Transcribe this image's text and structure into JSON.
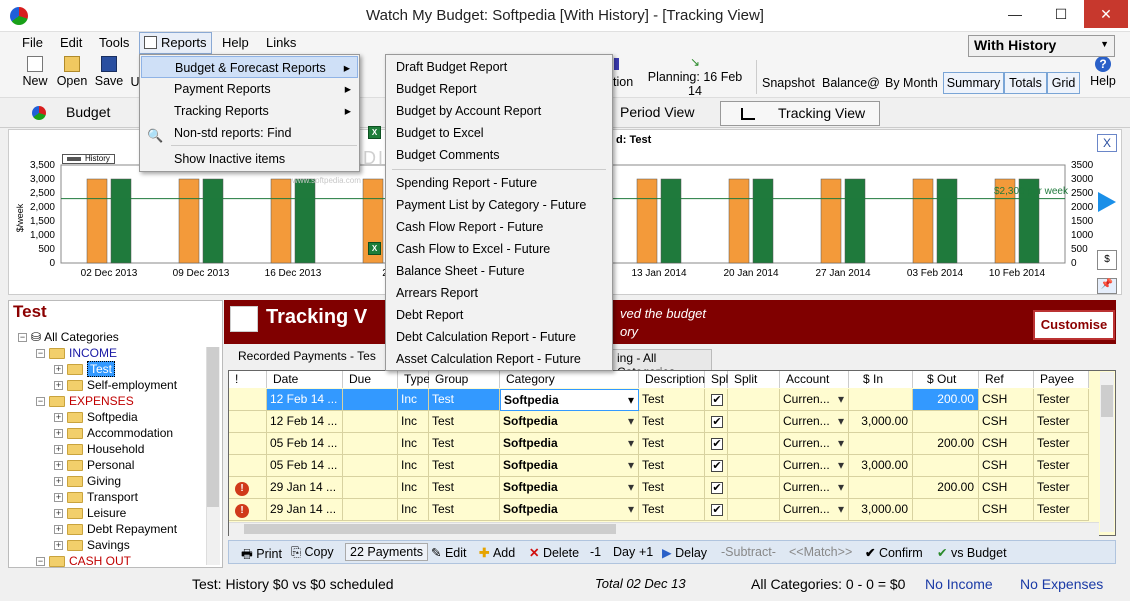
{
  "window": {
    "title": "Watch My Budget: Softpedia [With History] - [Tracking View]",
    "minimize": "—",
    "maximize": "☐",
    "close": "✕"
  },
  "menubar": {
    "items": [
      "File",
      "Edit",
      "Tools",
      "Reports",
      "Help",
      "Links"
    ]
  },
  "toolbar": {
    "new": "New",
    "open": "Open",
    "save": "Save",
    "cut_label": "U",
    "tion": "tion",
    "planning": "Planning: 16 Feb 14",
    "snapshot": "Snapshot",
    "balance": "Balance@",
    "by_month": "By Month",
    "summary": "Summary",
    "totals": "Totals",
    "grid": "Grid",
    "help": "Help",
    "history_select": "With History"
  },
  "viewbar": {
    "budget_view": "Budget View",
    "period_view": "Period View",
    "tracking_view": "Tracking View"
  },
  "chart": {
    "legend_history": "History",
    "right_label": "$2,300 per week",
    "fragment_title": "d: Test",
    "watermark": "SOFTPEDIA",
    "watermark_url": "www.softpedia.com"
  },
  "chart_data": {
    "type": "bar",
    "ylabel": "$/week",
    "ylim": [
      0,
      3500
    ],
    "y_ticks": [
      "3,500",
      "3,000",
      "2,500",
      "2,000",
      "1,500",
      "1,000",
      "500",
      "0"
    ],
    "y_ticks_right": [
      "3500",
      "3000",
      "2500",
      "2000",
      "1500",
      "1000",
      "500",
      "0"
    ],
    "categories": [
      "02 Dec 2013",
      "09 Dec 2013",
      "16 Dec 2013",
      "2",
      "13 Jan 2014",
      "20 Jan 2014",
      "27 Jan 2014",
      "03 Feb 2014",
      "10 Feb 2014"
    ],
    "reference_line": 2300,
    "series": [
      {
        "name": "",
        "color": "#f39a3a",
        "values": [
          3000,
          3000,
          3000,
          3000,
          3000,
          3000,
          3000,
          3000,
          3000
        ]
      },
      {
        "name": "",
        "color": "#1f7a3c",
        "values": [
          3000,
          3000,
          3000,
          3000,
          3000,
          3000,
          3000,
          3000,
          3000
        ]
      }
    ]
  },
  "tree": {
    "title": "Test",
    "items": [
      {
        "label": "All Categories",
        "color": "#000"
      },
      {
        "label": "INCOME",
        "color": "#1a1aa6"
      },
      {
        "label": "Test",
        "color": "#fff",
        "selected": true
      },
      {
        "label": "Self-employment",
        "color": "#000"
      },
      {
        "label": "EXPENSES",
        "color": "#c00000"
      },
      {
        "label": "Softpedia",
        "color": "#000"
      },
      {
        "label": "Accommodation",
        "color": "#000"
      },
      {
        "label": "Household",
        "color": "#000"
      },
      {
        "label": "Personal",
        "color": "#000"
      },
      {
        "label": "Giving",
        "color": "#000"
      },
      {
        "label": "Transport",
        "color": "#000"
      },
      {
        "label": "Leisure",
        "color": "#000"
      },
      {
        "label": "Debt Repayment",
        "color": "#000"
      },
      {
        "label": "Savings",
        "color": "#000"
      },
      {
        "label": "CASH OUT",
        "color": "#c00000"
      }
    ]
  },
  "tracking": {
    "title": "Tracking V",
    "line1": "ved the budget",
    "line2": "ory",
    "customise": "Customise",
    "recorded_tab": "Recorded Payments - Tes",
    "all_cat_tab": "ing - All Categories"
  },
  "grid": {
    "headers": [
      "!",
      "Date",
      "Due",
      "Type",
      "Group",
      "Category",
      "Description",
      "Spl",
      "Split",
      "Account",
      "$ In",
      "$ Out",
      "Ref",
      "Payee"
    ],
    "rows": [
      {
        "flag": "",
        "date": "12 Feb 14 ...",
        "type": "Inc",
        "group": "Test",
        "category": "Softpedia",
        "desc": "Test",
        "account": "Curren...",
        "in": "",
        "out": "200.00",
        "ref": "CSH",
        "payee": "Tester"
      },
      {
        "flag": "",
        "date": "12 Feb 14 ...",
        "type": "Inc",
        "group": "Test",
        "category": "Softpedia",
        "desc": "Test",
        "account": "Curren...",
        "in": "3,000.00",
        "out": "",
        "ref": "CSH",
        "payee": "Tester"
      },
      {
        "flag": "",
        "date": "05 Feb 14 ...",
        "type": "Inc",
        "group": "Test",
        "category": "Softpedia",
        "desc": "Test",
        "account": "Curren...",
        "in": "",
        "out": "200.00",
        "ref": "CSH",
        "payee": "Tester"
      },
      {
        "flag": "",
        "date": "05 Feb 14 ...",
        "type": "Inc",
        "group": "Test",
        "category": "Softpedia",
        "desc": "Test",
        "account": "Curren...",
        "in": "3,000.00",
        "out": "",
        "ref": "CSH",
        "payee": "Tester"
      },
      {
        "flag": "!",
        "date": "29 Jan 14 ...",
        "type": "Inc",
        "group": "Test",
        "category": "Softpedia",
        "desc": "Test",
        "account": "Curren...",
        "in": "",
        "out": "200.00",
        "ref": "CSH",
        "payee": "Tester"
      },
      {
        "flag": "!",
        "date": "29 Jan 14 ...",
        "type": "Inc",
        "group": "Test",
        "category": "Softpedia",
        "desc": "Test",
        "account": "Curren...",
        "in": "3,000.00",
        "out": "",
        "ref": "CSH",
        "payee": "Tester"
      }
    ]
  },
  "bottom_bar": {
    "print": "Print",
    "copy": "Copy",
    "payments": "22 Payments",
    "edit": "Edit",
    "add": "Add",
    "delete": "Delete",
    "minus1": "-1",
    "day": "Day",
    "plus1": "+1",
    "delay": "Delay",
    "subtract": "-Subtract-",
    "match": "<<Match>>",
    "confirm": "Confirm",
    "vs_budget": "vs Budget"
  },
  "status": {
    "left": "Test: History $0 vs $0 scheduled",
    "total": "Total 02 Dec 13",
    "all_cat": "All Categories: 0 - 0 = $0",
    "no_income": "No Income",
    "no_expenses": "No Expenses"
  },
  "reports_menu": {
    "items": [
      "Budget & Forecast Reports",
      "Payment Reports",
      "Tracking Reports",
      "Non-std reports:  Find",
      "Show Inactive items"
    ]
  },
  "budget_forecast_submenu": {
    "items": [
      "Draft Budget Report",
      "Budget Report",
      "Budget by Account Report",
      "Budget to Excel",
      "Budget Comments",
      "Spending Report - Future",
      "Payment List by Category - Future",
      "Cash Flow Report - Future",
      "Cash Flow to Excel - Future",
      "Balance Sheet - Future",
      "Arrears Report",
      "Debt Report",
      "Debt Calculation Report - Future",
      "Asset Calculation Report - Future"
    ]
  }
}
